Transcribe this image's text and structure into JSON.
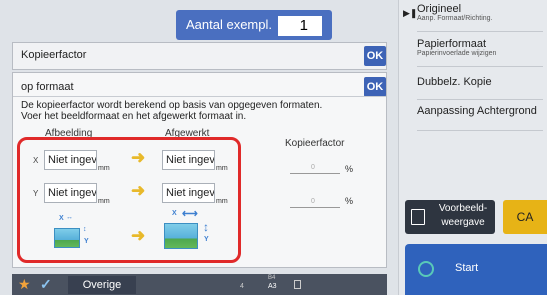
{
  "header": {
    "copies_label": "Aantal exempl.",
    "copies_value": "1"
  },
  "right_panel": {
    "items": [
      {
        "main": "Origineel",
        "sub": "Aanp. Formaat/Richting."
      },
      {
        "main": "Papierformaat",
        "sub": "Papierinvoerlade wijzigen"
      },
      {
        "main": "Dubbelz. Kopie",
        "sub": ""
      },
      {
        "main": "Aanpassing Achtergrond",
        "sub": ""
      }
    ],
    "preview_label": "Voorbeeld-\nweergave",
    "ca_label": "CA",
    "start_label": "Start"
  },
  "dialog1": {
    "title": "Kopieerfactor",
    "ok": "OK"
  },
  "dialog2": {
    "title": "op formaat",
    "ok": "OK",
    "description_line1": "De kopieerfactor wordt berekend op basis van opgegeven formaten.",
    "description_line2": "Voer het beeldformaat en het afgewerkt formaat in.",
    "col_image": "Afbeelding",
    "col_finished": "Afgewerkt",
    "x_label": "X",
    "y_label": "Y",
    "x_image_value": "Niet ingev",
    "x_finished_value": "Niet ingev",
    "y_image_value": "Niet ingev",
    "y_finished_value": "Niet ingev",
    "unit": "mm",
    "factor_title": "Kopieerfactor",
    "factor_x_placeholder": "0",
    "factor_y_placeholder": "0",
    "percent": "%",
    "icon_tag_xy_x": "X",
    "icon_tag_xy_y": "Y"
  },
  "bottom_bar": {
    "other_label": "Overige",
    "tray_number": "4",
    "tray_size": "A3",
    "tray_top": "B4"
  },
  "colors": {
    "accent_blue": "#3d63b6",
    "highlight_red": "#e02a2a",
    "ca_yellow": "#e7b316",
    "start_blue": "#2f62bc"
  }
}
